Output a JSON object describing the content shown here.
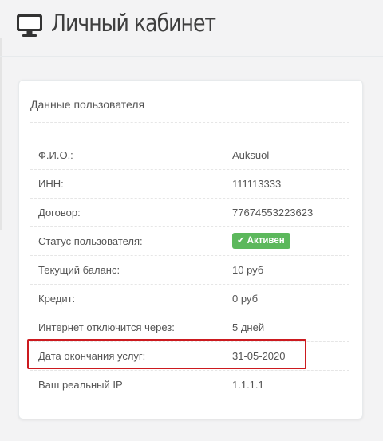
{
  "header": {
    "title": "Личный кабинет",
    "icon": "monitor-icon"
  },
  "panel": {
    "title": "Данные пользователя",
    "rows": [
      {
        "label": "Ф.И.О.:",
        "value": "Auksuol"
      },
      {
        "label": "ИНН:",
        "value": "111113333"
      },
      {
        "label": "Договор:",
        "value": "77674553223623"
      },
      {
        "label": "Статус пользователя:",
        "badge": "Активен",
        "badge_color": "#5cb85c",
        "badge_icon": "check-icon"
      },
      {
        "label": "Текущий баланс:",
        "value": "10 руб"
      },
      {
        "label": "Кредит:",
        "value": "0 руб"
      },
      {
        "label": "Интернет отключится через:",
        "value": "5 дней"
      },
      {
        "label": "Дата окончания услуг:",
        "value": "31-05-2020"
      },
      {
        "label": "Ваш реальный IP",
        "value": "1.1.1.1"
      }
    ]
  },
  "highlight": {
    "color": "#cc1a1f",
    "row": "Дата окончания услуг:"
  }
}
